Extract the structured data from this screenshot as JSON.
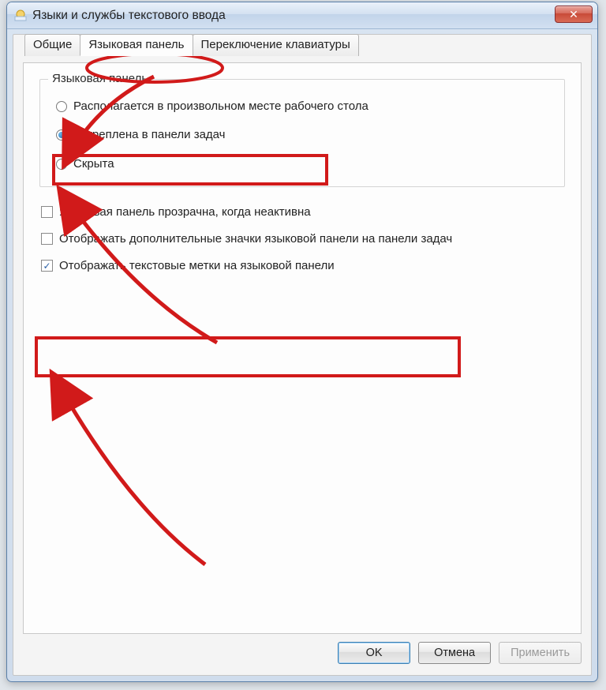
{
  "window": {
    "title": "Языки и службы текстового ввода"
  },
  "tabs": {
    "general": "Общие",
    "langbar": "Языковая панель",
    "switch": "Переключение клавиатуры",
    "active": "langbar"
  },
  "group": {
    "title": "Языковая панель",
    "radios": {
      "float": "Располагается в произвольном месте рабочего стола",
      "docked": "Закреплена в панели задач",
      "hidden": "Скрыта",
      "selected": "docked"
    }
  },
  "checks": {
    "transparent": {
      "label": "Языковая панель прозрачна, когда неактивна",
      "checked": false
    },
    "extra_icons": {
      "label": "Отображать дополнительные значки языковой панели на панели задач",
      "checked": false
    },
    "text_labels": {
      "label": "Отображать текстовые метки на языковой панели",
      "checked": true
    }
  },
  "buttons": {
    "ok": "OK",
    "cancel": "Отмена",
    "apply": "Применить"
  }
}
